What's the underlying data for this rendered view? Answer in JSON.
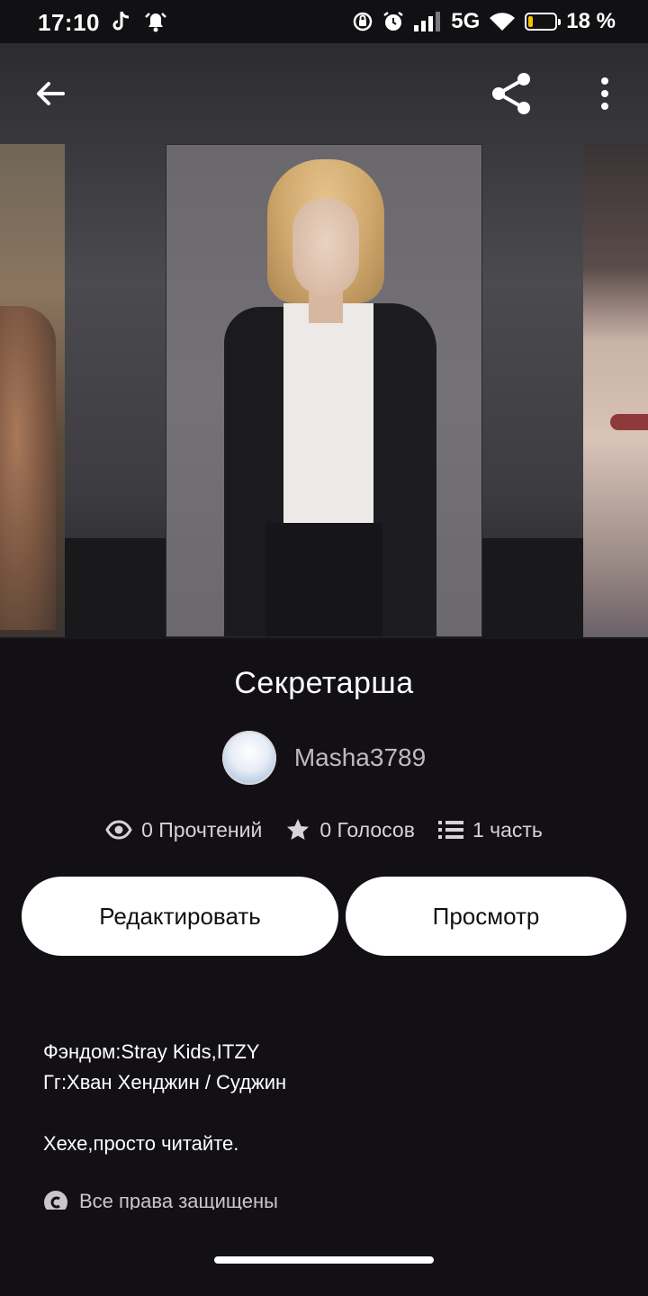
{
  "status_bar": {
    "time": "17:10",
    "network": "5G",
    "battery_percent": "18 %",
    "battery_level": 0.18,
    "battery_color": "#f2c200"
  },
  "app_bar": {
    "back_icon": "arrow-left-icon",
    "share_icon": "share-icon",
    "more_icon": "more-vertical-icon"
  },
  "story": {
    "title": "Секретарша",
    "author": "Masha3789",
    "stats": {
      "reads": "0 Прочтений",
      "votes": "0 Голосов",
      "parts": "1 часть"
    }
  },
  "actions": {
    "edit_label": "Редактировать",
    "view_label": "Просмотр"
  },
  "description": {
    "fandom": "Фэндом:Stray Kids,ITZY",
    "pairing": "Гг:Хван Хенджин / Суджин",
    "summary": "Хехе,просто читайте.",
    "rights": "Все права защищены"
  },
  "colors": {
    "background": "#121014",
    "button_bg": "#ffffff",
    "muted_text": "#bdbbc1"
  }
}
